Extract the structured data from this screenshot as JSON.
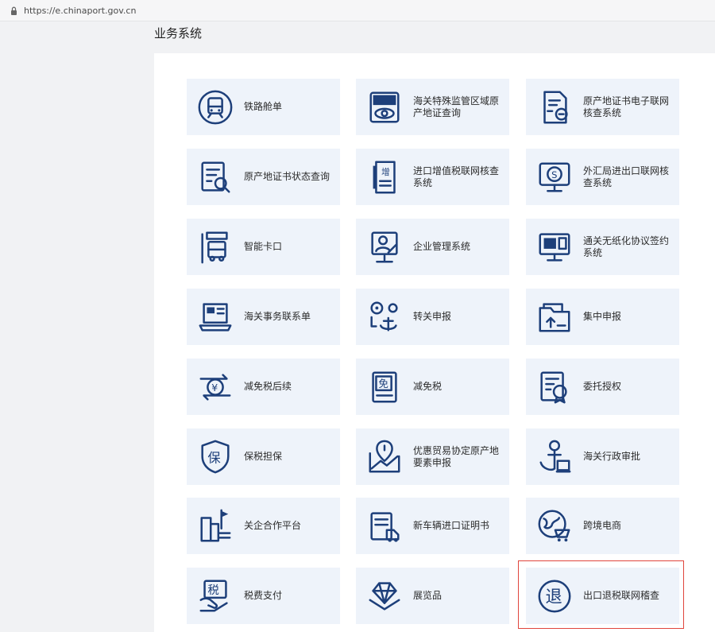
{
  "browser": {
    "url": "https://e.chinaport.gov.cn"
  },
  "page": {
    "title": "业务系统"
  },
  "tiles": [
    {
      "label": "铁路舱单",
      "icon": "train-icon"
    },
    {
      "label": "海关特殊监管区域原产地证查询",
      "icon": "special-zone-eye-icon"
    },
    {
      "label": "原产地证书电子联网核查系统",
      "icon": "certificate-seal-icon"
    },
    {
      "label": "原产地证书状态查询",
      "icon": "document-search-icon"
    },
    {
      "label": "进口增值税联网核查系统",
      "icon": "vat-document-icon"
    },
    {
      "label": "外汇局进出口联网核查系统",
      "icon": "monitor-currency-icon"
    },
    {
      "label": "智能卡口",
      "icon": "gate-truck-icon"
    },
    {
      "label": "企业管理系统",
      "icon": "enterprise-user-icon"
    },
    {
      "label": "通关无纸化协议签约系统",
      "icon": "paperless-agreement-icon"
    },
    {
      "label": "海关事务联系单",
      "icon": "laptop-contact-icon"
    },
    {
      "label": "转关申报",
      "icon": "transit-anchor-icon"
    },
    {
      "label": "集中申报",
      "icon": "folder-upload-icon"
    },
    {
      "label": "减免税后续",
      "icon": "currency-exchange-icon"
    },
    {
      "label": "减免税",
      "icon": "exempt-document-icon"
    },
    {
      "label": "委托授权",
      "icon": "authorization-badge-icon"
    },
    {
      "label": "保税担保",
      "icon": "bonded-shield-icon"
    },
    {
      "label": "优惠贸易协定原产地要素申报",
      "icon": "map-pin-chart-icon"
    },
    {
      "label": "海关行政审批",
      "icon": "approval-anchor-icon"
    },
    {
      "label": "关企合作平台",
      "icon": "city-flag-icon"
    },
    {
      "label": "新车辆进口证明书",
      "icon": "vehicle-document-icon"
    },
    {
      "label": "跨境电商",
      "icon": "globe-cart-icon"
    },
    {
      "label": "税费支付",
      "icon": "tax-payment-icon"
    },
    {
      "label": "展览品",
      "icon": "diamond-box-icon"
    },
    {
      "label": "出口退税联网稽查",
      "icon": "tax-refund-icon"
    }
  ],
  "colors": {
    "icon": "#1d3f7a",
    "tile_bg": "#eef3fa",
    "highlight": "#e0453c"
  },
  "highlighted_tile": "出口退税联网稽查"
}
